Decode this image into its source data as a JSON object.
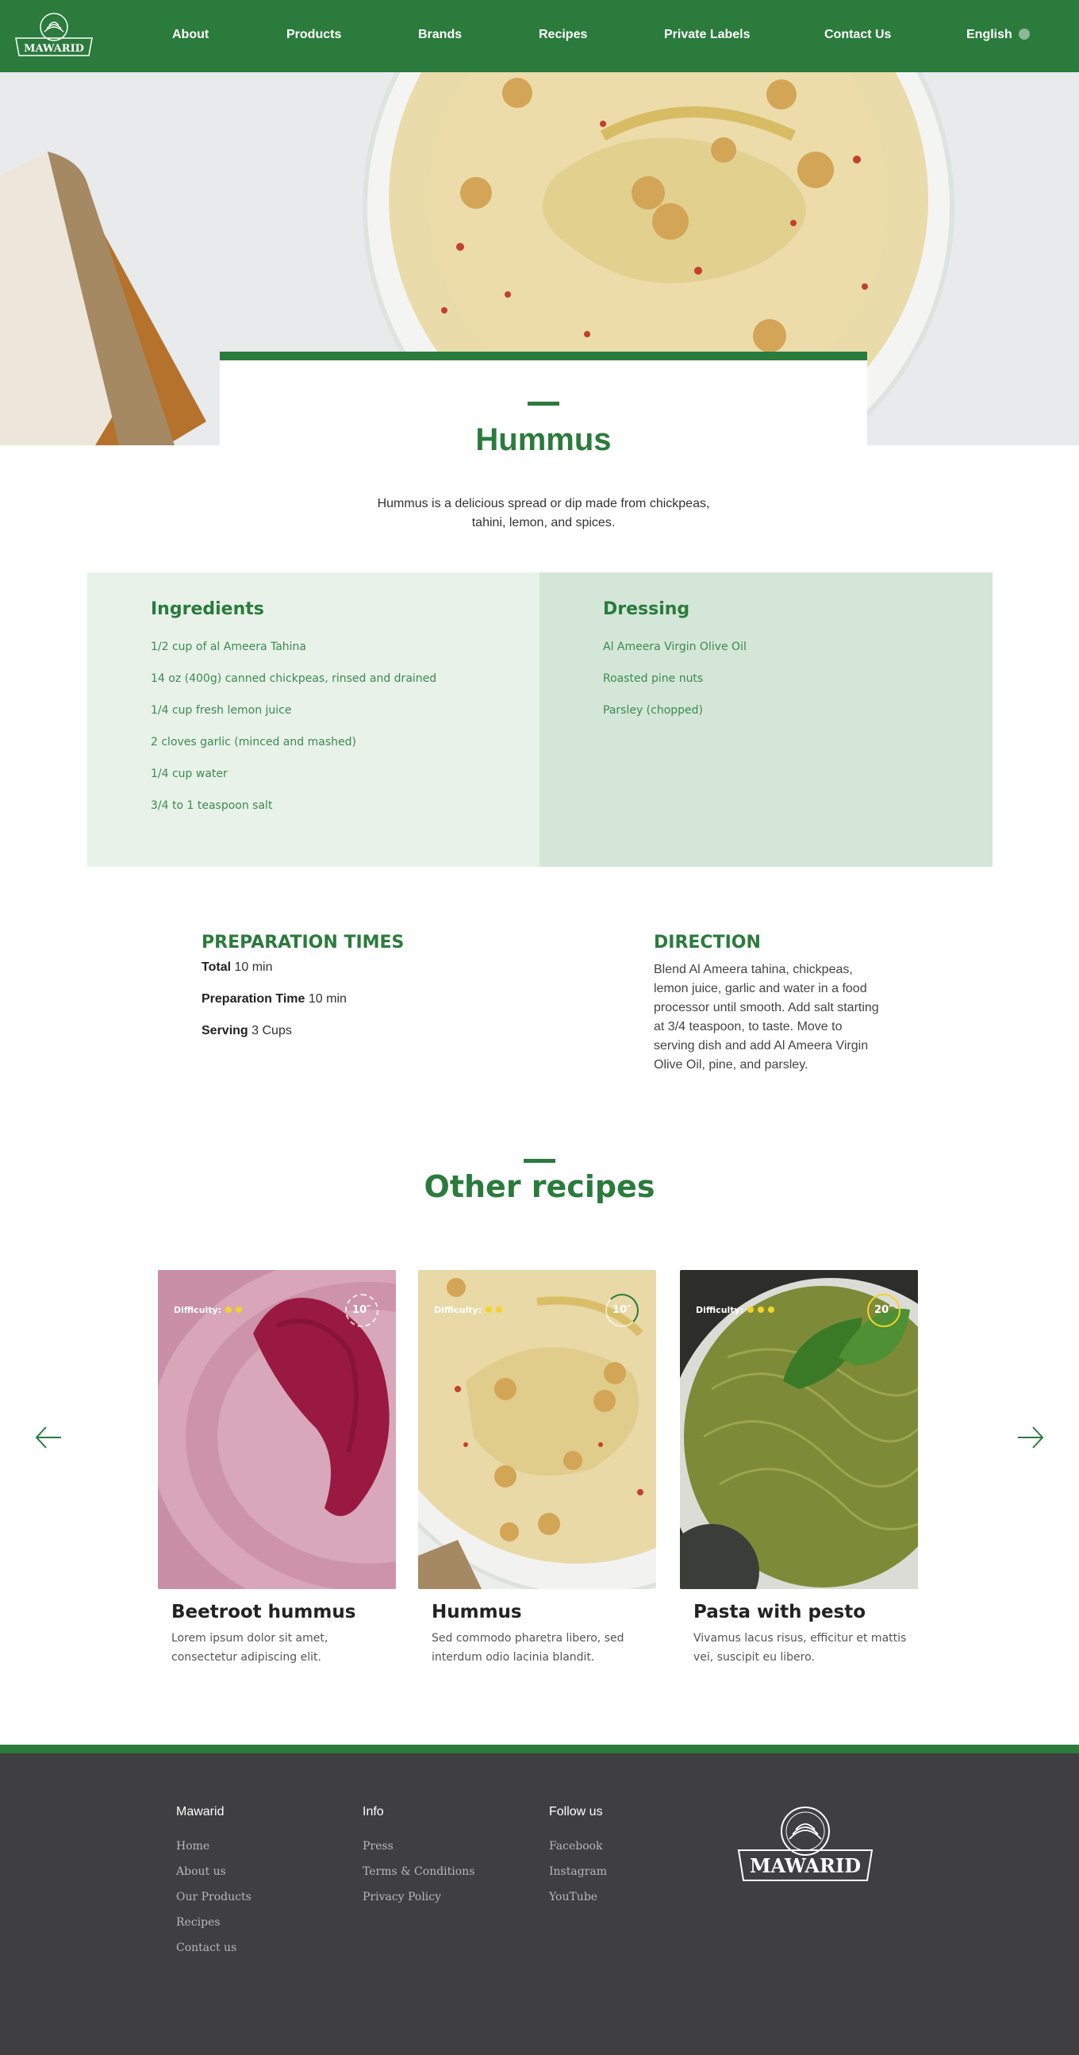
{
  "header": {
    "logo_text": "MAWARID",
    "nav": [
      "About",
      "Products",
      "Brands",
      "Recipes",
      "Private Labels",
      "Contact Us"
    ],
    "language": "English"
  },
  "recipe": {
    "title": "Hummus",
    "description": "Hummus is a delicious spread or dip made from chickpeas, tahini, lemon, and spices.",
    "ingredients_title": "Ingredients",
    "ingredients": [
      "1/2 cup of al Ameera Tahina",
      "14 oz (400g) canned chickpeas, rinsed and drained",
      "1/4 cup fresh lemon juice",
      "2 cloves garlic (minced and mashed)",
      "1/4 cup water",
      "3/4 to 1 teaspoon salt"
    ],
    "dressing_title": "Dressing",
    "dressing": [
      "Al Ameera Virgin Olive Oil",
      "Roasted pine nuts",
      "Parsley (chopped)"
    ],
    "prep_title": "PREPARATION TIMES",
    "prep": [
      {
        "label": "Total",
        "value": "10 min"
      },
      {
        "label": "Preparation Time",
        "value": "10 min"
      },
      {
        "label": "Serving",
        "value": "3 Cups"
      }
    ],
    "direction_title": "DIRECTION",
    "direction": "Blend Al Ameera tahina, chickpeas, lemon juice, garlic and water in a food processor until smooth. Add salt starting at 3/4 teaspoon, to taste. Move to serving dish and add Al Ameera Virgin Olive Oil, pine, and parsley."
  },
  "other": {
    "title": "Other recipes",
    "difficulty_label": "Difficulty:",
    "cards": [
      {
        "title": "Beetroot hummus",
        "desc": "Lorem ipsum dolor sit amet, consectetur adipiscing elit.",
        "time": "10″",
        "difficulty": 2
      },
      {
        "title": "Hummus",
        "desc": "Sed commodo pharetra libero, sed interdum odio lacinia blandit.",
        "time": "10″",
        "difficulty": 2
      },
      {
        "title": "Pasta with pesto",
        "desc": "Vivamus lacus risus, efficitur et mattis vei, suscipit eu libero.",
        "time": "20″",
        "difficulty": 3
      }
    ]
  },
  "footer": {
    "col1_title": "Mawarid",
    "col1": [
      "Home",
      "About us",
      "Our Products",
      "Recipes",
      "Contact us"
    ],
    "col2_title": "Info",
    "col2": [
      "Press",
      "Terms & Conditions",
      "Privacy Policy"
    ],
    "col3_title": "Follow us",
    "col3": [
      "Facebook",
      "Instagram",
      "YouTube"
    ],
    "logo_text": "MAWARID"
  },
  "colors": {
    "brand_green": "#2a7b3c",
    "footer_bg": "#3f3e40",
    "difficulty_dot": "#f3d32a"
  }
}
